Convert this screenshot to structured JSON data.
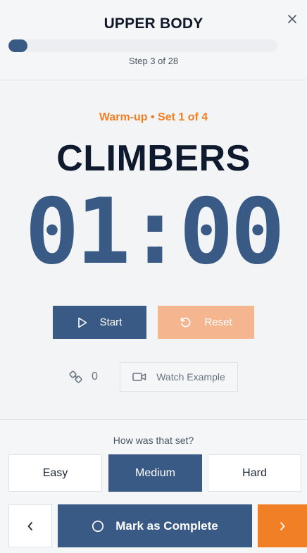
{
  "header": {
    "title": "UPPER BODY",
    "close_icon": "close-icon",
    "progress": {
      "current": 3,
      "total": 28,
      "fraction": 0.0714
    },
    "step_text": "Step 3 of 28"
  },
  "exercise": {
    "set_label": "Warm-up • Set 1 of 4",
    "name": "CLIMBERS",
    "timer": "01:00"
  },
  "controls": {
    "start_label": "Start",
    "start_icon": "play-icon",
    "reset_label": "Reset",
    "reset_icon": "reset-icon",
    "counter_icon": "swap-icon",
    "counter_value": "0",
    "watch_label": "Watch Example",
    "watch_icon": "video-camera-icon"
  },
  "feedback": {
    "question": "How was that set?",
    "options": [
      "Easy",
      "Medium",
      "Hard"
    ],
    "selected": "Medium"
  },
  "nav": {
    "prev_icon": "chevron-left-icon",
    "complete_label": "Mark as Complete",
    "complete_icon": "circle-icon",
    "next_icon": "chevron-right-icon"
  },
  "colors": {
    "primary": "#3a5a86",
    "accent": "#f07f25",
    "reset_disabled": "#f5b58f",
    "background": "#f3f4f6"
  }
}
